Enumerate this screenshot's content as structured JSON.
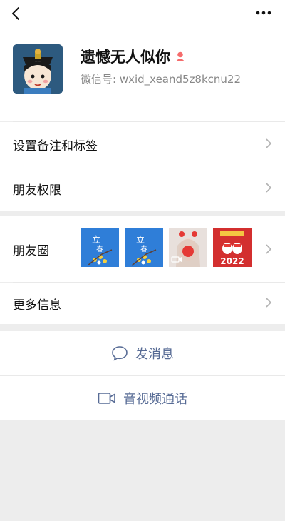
{
  "profile": {
    "name": "遗憾无人似你",
    "wechat_id": "微信号: wxid_xeand5z8kcnu22"
  },
  "menu": {
    "remark_tags": "设置备注和标签",
    "friend_permissions": "朋友权限",
    "moments": "朋友圈",
    "more_info": "更多信息"
  },
  "moments_thumbs": [
    {
      "kind": "image",
      "text": ""
    },
    {
      "kind": "image",
      "text": ""
    },
    {
      "kind": "video",
      "text": ""
    },
    {
      "kind": "image",
      "text": "2022"
    }
  ],
  "actions": {
    "send_message": "发消息",
    "video_call": "音视频通话"
  },
  "colors": {
    "link": "#576b95",
    "page_bg": "#ededed",
    "gender_icon": "#f56c6c"
  }
}
